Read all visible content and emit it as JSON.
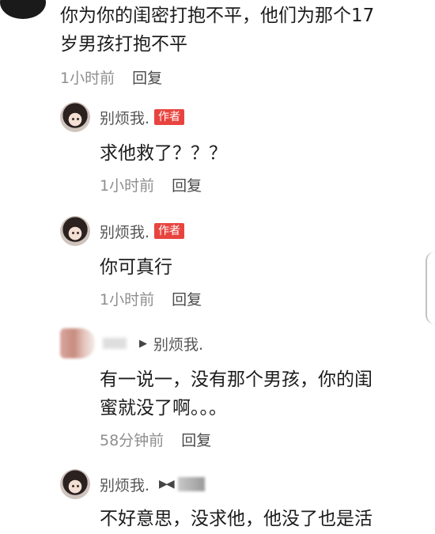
{
  "top_comment": {
    "text_line1": "你为你的闺密打抱不平，他们为那个17",
    "text_line2": "岁男孩打抱不平",
    "time": "1小时前",
    "reply_label": "回复"
  },
  "replies": [
    {
      "username": "别烦我.",
      "badge": "作者",
      "text": "求他救了？？？",
      "time": "1小时前",
      "reply_label": "回复"
    },
    {
      "username": "别烦我.",
      "badge": "作者",
      "text": "你可真行",
      "time": "1小时前",
      "reply_label": "回复"
    },
    {
      "reply_to": "别烦我.",
      "text_line1": "有一说一，没有那个男孩，你的闺",
      "text_line2": "蜜就没了啊。。。",
      "time": "58分钟前",
      "reply_label": "回复"
    },
    {
      "username": "别烦我.",
      "text": "不好意思，没求他，他没了也是活"
    }
  ],
  "icons": {
    "reply_arrow": "right-triangle-icon",
    "send_arrow": "send-arrow-icon"
  },
  "colors": {
    "badge_bg": "#e8443f",
    "meta_text": "#8e8e8e"
  }
}
